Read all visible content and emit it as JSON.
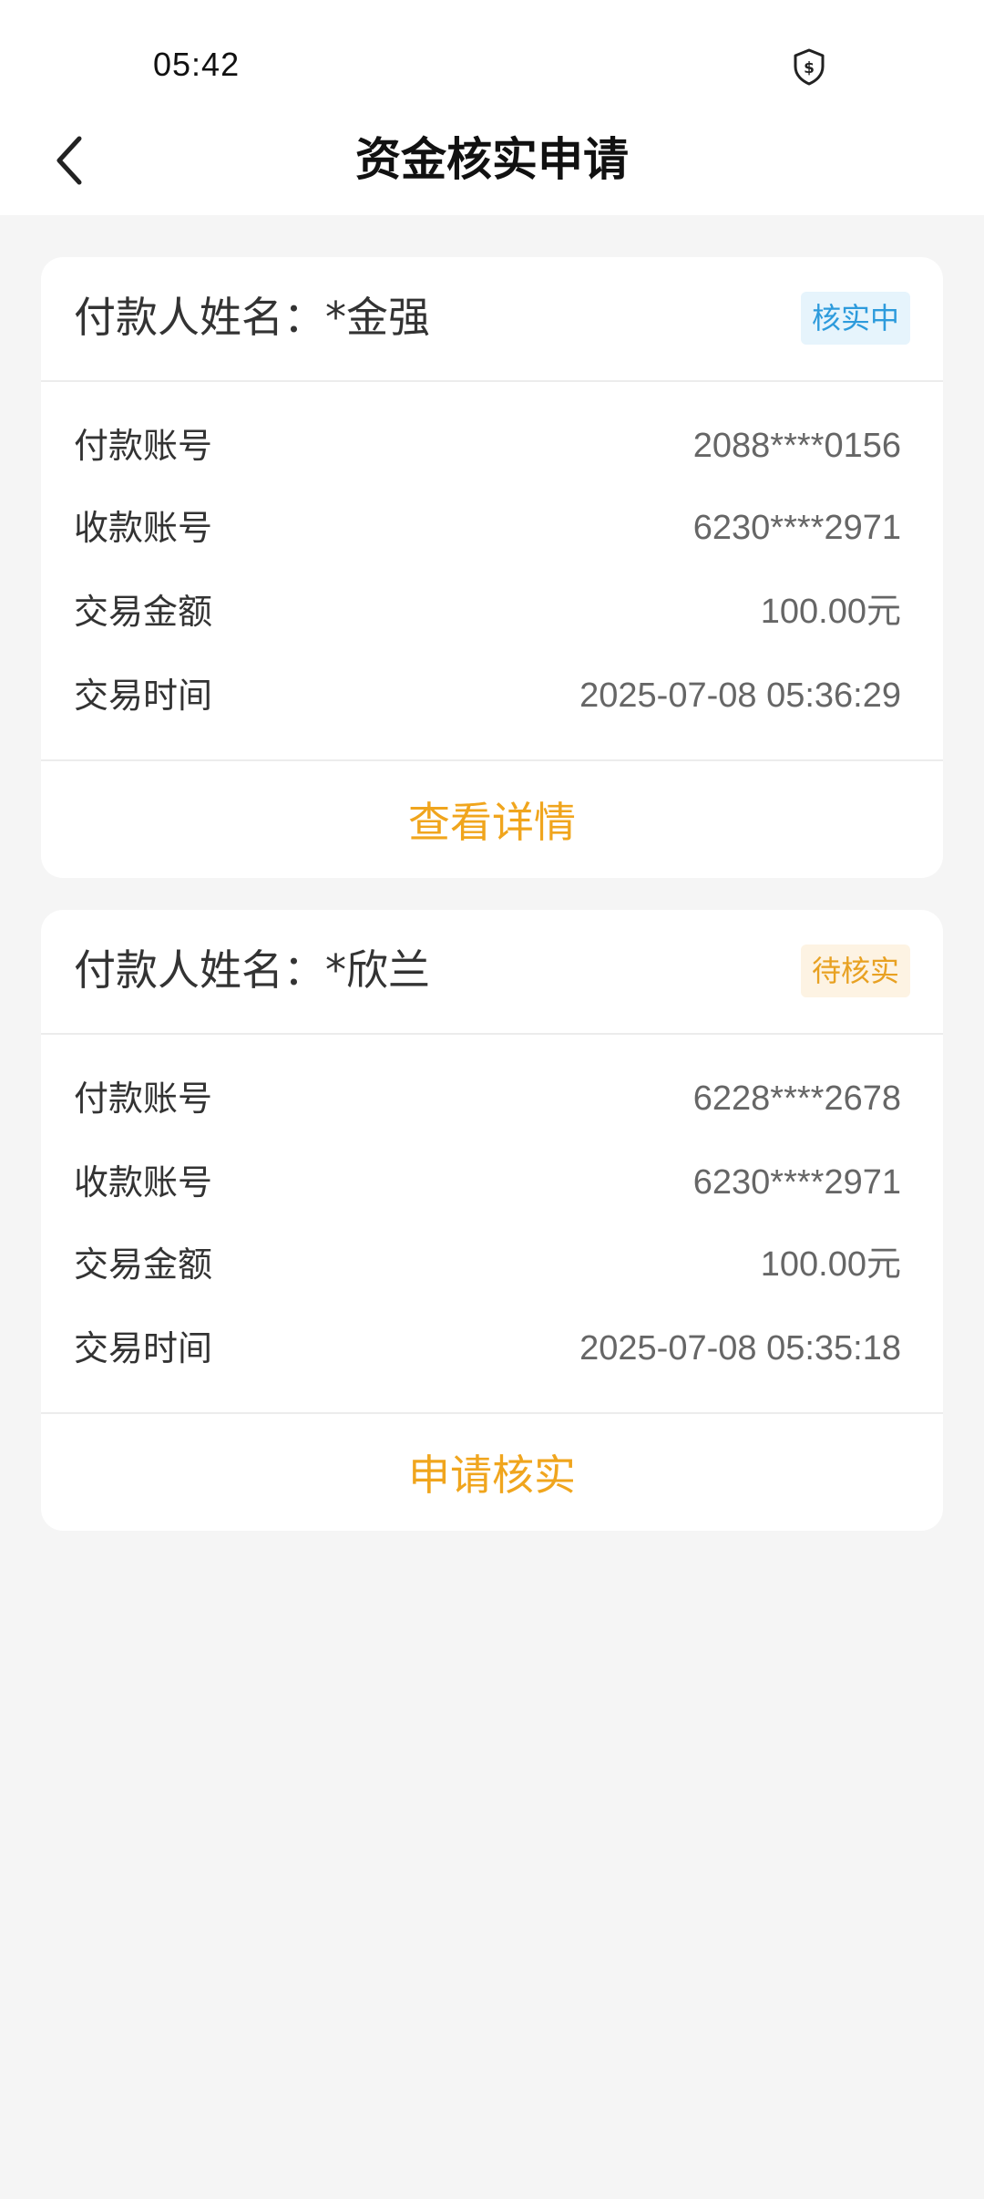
{
  "status_bar": {
    "time": "05:42",
    "shield_icon": "shield-dollar-icon"
  },
  "header": {
    "back_icon": "chevron-left-icon",
    "title": "资金核实申请"
  },
  "colors": {
    "accent": "#f0a51d",
    "badge_blue_text": "#2d9bdc",
    "badge_blue_bg": "#e6f4fc",
    "badge_orange_text": "#e8a122",
    "badge_orange_bg": "#fdf3e3"
  },
  "cards": [
    {
      "payer": "付款人姓名：*金强",
      "status": "核实中",
      "rows": [
        {
          "label": "付款账号",
          "value": "2088****0156"
        },
        {
          "label": "收款账号",
          "value": "6230****2971"
        },
        {
          "label": "交易金额",
          "value": "100.00元"
        },
        {
          "label": "交易时间",
          "value": "2025-07-08 05:36:29"
        }
      ],
      "action": "查看详情"
    },
    {
      "payer": "付款人姓名：*欣兰",
      "status": "待核实",
      "rows": [
        {
          "label": "付款账号",
          "value": "6228****2678"
        },
        {
          "label": "收款账号",
          "value": "6230****2971"
        },
        {
          "label": "交易金额",
          "value": "100.00元"
        },
        {
          "label": "交易时间",
          "value": "2025-07-08 05:35:18"
        }
      ],
      "action": "申请核实"
    }
  ]
}
